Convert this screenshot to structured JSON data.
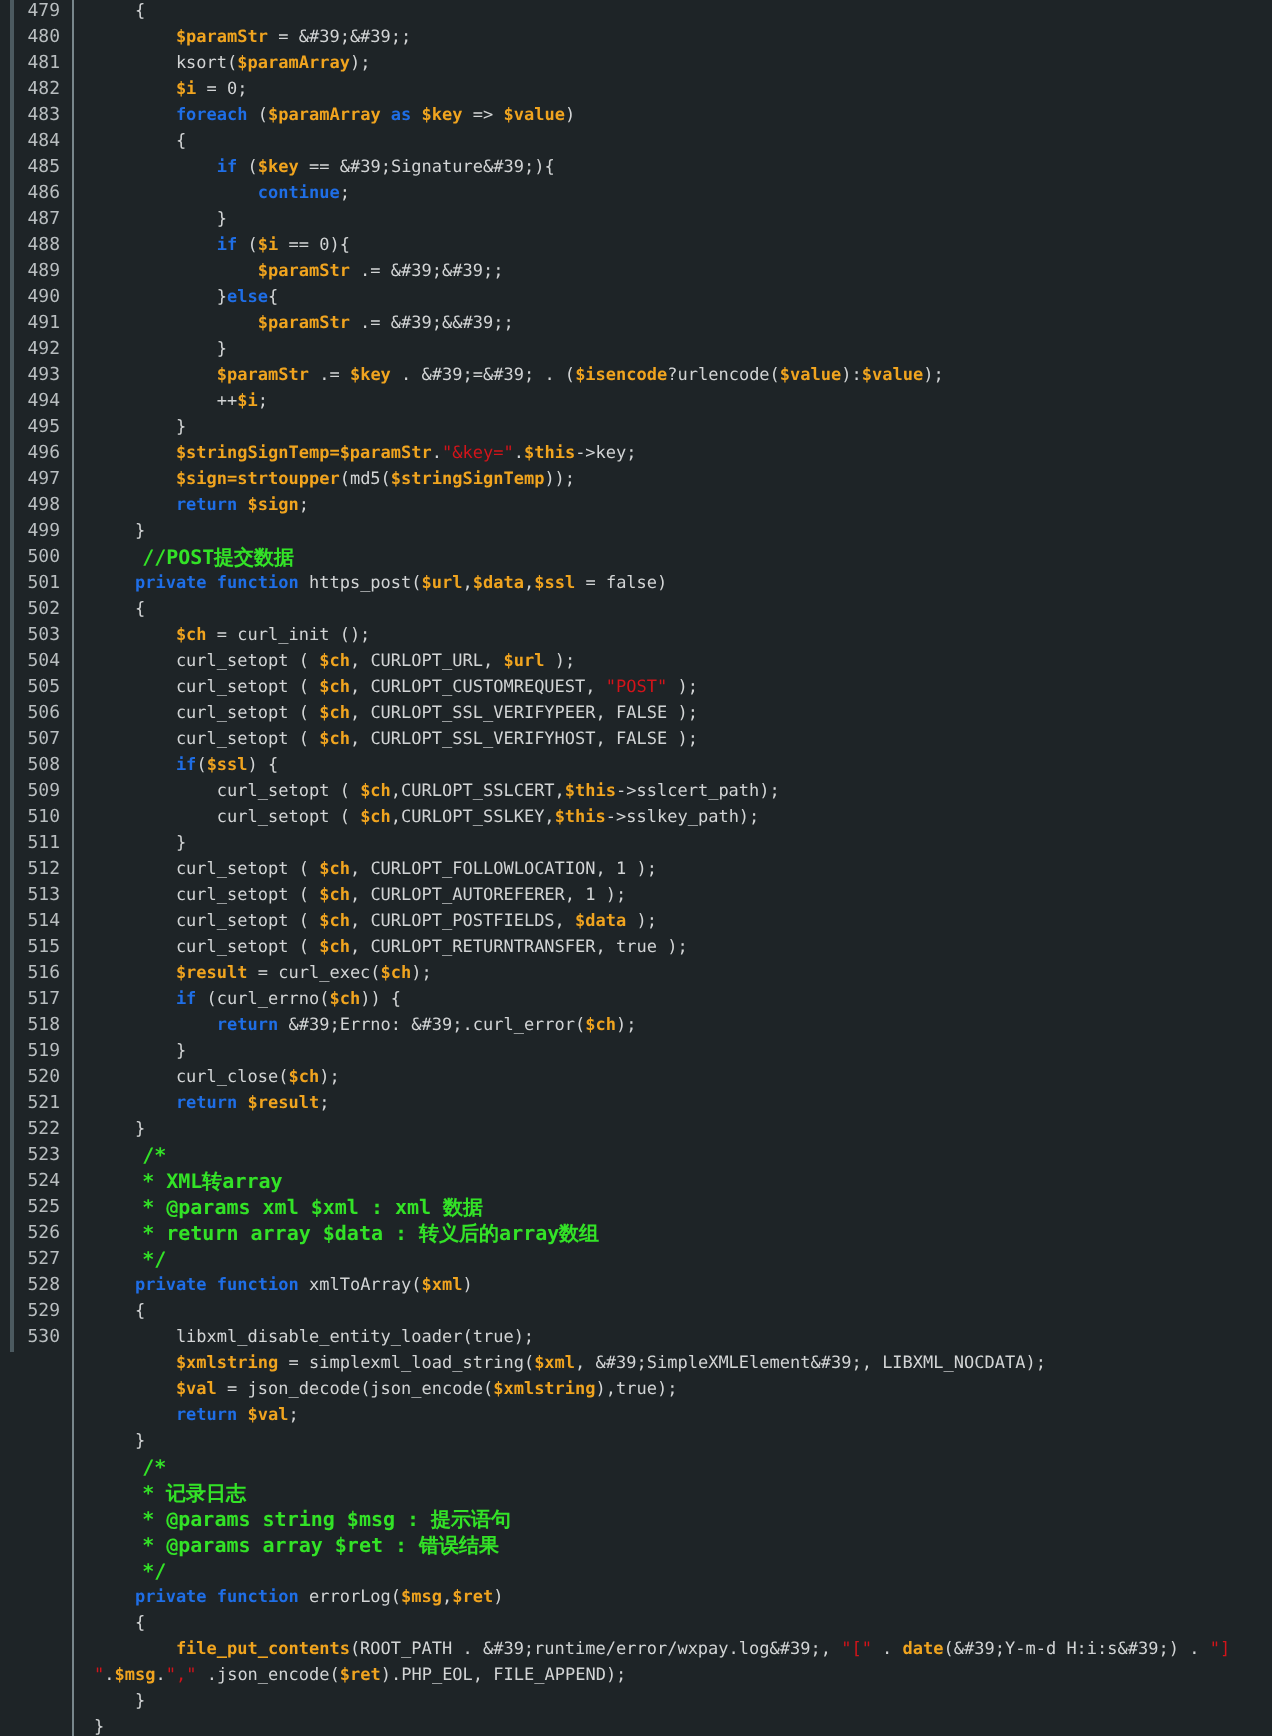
{
  "editor": {
    "lines": [
      {
        "number": "479",
        "tokens": [
          {
            "kind": "plain",
            "text": "    {"
          }
        ]
      },
      {
        "number": "480",
        "tokens": [
          {
            "kind": "variable",
            "text": "        $paramStr"
          },
          {
            "kind": "plain",
            "text": " = &#39;&#39;;"
          }
        ]
      },
      {
        "number": "481",
        "tokens": [
          {
            "kind": "plain",
            "text": "        ksort("
          },
          {
            "kind": "variable",
            "text": "$paramArray"
          },
          {
            "kind": "plain",
            "text": ");"
          }
        ]
      },
      {
        "number": "482",
        "tokens": [
          {
            "kind": "variable",
            "text": "        $i"
          },
          {
            "kind": "plain",
            "text": " = 0;"
          }
        ]
      },
      {
        "number": "483",
        "tokens": [
          {
            "kind": "keyword",
            "text": "        foreach"
          },
          {
            "kind": "plain",
            "text": " ("
          },
          {
            "kind": "variable",
            "text": "$paramArray"
          },
          {
            "kind": "keyword",
            "text": " as "
          },
          {
            "kind": "variable",
            "text": "$key"
          },
          {
            "kind": "plain",
            "text": " => "
          },
          {
            "kind": "variable",
            "text": "$value"
          },
          {
            "kind": "plain",
            "text": ")"
          }
        ]
      },
      {
        "number": "484",
        "tokens": [
          {
            "kind": "plain",
            "text": "        {"
          }
        ]
      },
      {
        "number": "485",
        "tokens": [
          {
            "kind": "keyword",
            "text": "            if"
          },
          {
            "kind": "plain",
            "text": " ("
          },
          {
            "kind": "variable",
            "text": "$key"
          },
          {
            "kind": "plain",
            "text": " == &#39;Signature&#39;){"
          }
        ]
      },
      {
        "number": "486",
        "tokens": [
          {
            "kind": "keyword",
            "text": "                continue"
          },
          {
            "kind": "plain",
            "text": ";"
          }
        ]
      },
      {
        "number": "487",
        "tokens": [
          {
            "kind": "plain",
            "text": "            }"
          }
        ]
      },
      {
        "number": "488",
        "tokens": [
          {
            "kind": "keyword",
            "text": "            if"
          },
          {
            "kind": "plain",
            "text": " ("
          },
          {
            "kind": "variable",
            "text": "$i"
          },
          {
            "kind": "plain",
            "text": " == 0){"
          }
        ]
      },
      {
        "number": "489",
        "tokens": [
          {
            "kind": "variable",
            "text": "                $paramStr"
          },
          {
            "kind": "plain",
            "text": " .= &#39;&#39;;"
          }
        ]
      },
      {
        "number": "490",
        "tokens": [
          {
            "kind": "plain",
            "text": "            }"
          },
          {
            "kind": "keyword",
            "text": "else"
          },
          {
            "kind": "plain",
            "text": "{"
          }
        ]
      },
      {
        "number": "491",
        "tokens": [
          {
            "kind": "variable",
            "text": "                $paramStr"
          },
          {
            "kind": "plain",
            "text": " .= &#39;&&#39;;"
          }
        ]
      },
      {
        "number": "492",
        "tokens": [
          {
            "kind": "plain",
            "text": "            }"
          }
        ]
      },
      {
        "number": "493",
        "tokens": [
          {
            "kind": "variable",
            "text": "            $paramStr"
          },
          {
            "kind": "plain",
            "text": " .= "
          },
          {
            "kind": "variable",
            "text": "$key"
          },
          {
            "kind": "plain",
            "text": " . &#39;=&#39; . ("
          },
          {
            "kind": "variable",
            "text": "$isencode"
          },
          {
            "kind": "plain",
            "text": "?urlencode("
          },
          {
            "kind": "variable",
            "text": "$value"
          },
          {
            "kind": "plain",
            "text": "):"
          },
          {
            "kind": "variable",
            "text": "$value"
          },
          {
            "kind": "plain",
            "text": ");"
          }
        ]
      },
      {
        "number": "494",
        "tokens": [
          {
            "kind": "plain",
            "text": "            ++"
          },
          {
            "kind": "variable",
            "text": "$i"
          },
          {
            "kind": "plain",
            "text": ";"
          }
        ]
      },
      {
        "number": "495",
        "tokens": [
          {
            "kind": "plain",
            "text": "        }"
          }
        ]
      },
      {
        "number": "496",
        "tokens": [
          {
            "kind": "variable",
            "text": "        $stringSignTemp=$paramStr"
          },
          {
            "kind": "plain",
            "text": "."
          },
          {
            "kind": "string",
            "text": "\"&key=\""
          },
          {
            "kind": "plain",
            "text": "."
          },
          {
            "kind": "variable",
            "text": "$this"
          },
          {
            "kind": "plain",
            "text": "->key;"
          }
        ]
      },
      {
        "number": "497",
        "tokens": [
          {
            "kind": "variable",
            "text": "        $sign=strtoupper"
          },
          {
            "kind": "plain",
            "text": "(md5("
          },
          {
            "kind": "variable",
            "text": "$stringSignTemp"
          },
          {
            "kind": "plain",
            "text": "));"
          }
        ]
      },
      {
        "number": "498",
        "tokens": [
          {
            "kind": "keyword",
            "text": "        return "
          },
          {
            "kind": "variable",
            "text": "$sign"
          },
          {
            "kind": "plain",
            "text": ";"
          }
        ]
      },
      {
        "number": "499",
        "tokens": [
          {
            "kind": "plain",
            "text": "    }"
          }
        ]
      },
      {
        "number": "500",
        "tokens": [
          {
            "kind": "comment",
            "text": "    //POST提交数据"
          }
        ]
      },
      {
        "number": "501",
        "tokens": [
          {
            "kind": "keyword",
            "text": "    private function"
          },
          {
            "kind": "plain",
            "text": " https_post("
          },
          {
            "kind": "variable",
            "text": "$url"
          },
          {
            "kind": "plain",
            "text": ","
          },
          {
            "kind": "variable",
            "text": "$data"
          },
          {
            "kind": "plain",
            "text": ","
          },
          {
            "kind": "variable",
            "text": "$ssl"
          },
          {
            "kind": "plain",
            "text": " = false)"
          }
        ]
      },
      {
        "number": "502",
        "tokens": [
          {
            "kind": "plain",
            "text": "    {"
          }
        ]
      },
      {
        "number": "503",
        "tokens": [
          {
            "kind": "variable",
            "text": "        $ch"
          },
          {
            "kind": "plain",
            "text": " = curl_init ();"
          }
        ]
      },
      {
        "number": "504",
        "tokens": [
          {
            "kind": "plain",
            "text": "        curl_setopt ( "
          },
          {
            "kind": "variable",
            "text": "$ch"
          },
          {
            "kind": "plain",
            "text": ", CURLOPT_URL, "
          },
          {
            "kind": "variable",
            "text": "$url"
          },
          {
            "kind": "plain",
            "text": " );"
          }
        ]
      },
      {
        "number": "505",
        "tokens": [
          {
            "kind": "plain",
            "text": "        curl_setopt ( "
          },
          {
            "kind": "variable",
            "text": "$ch"
          },
          {
            "kind": "plain",
            "text": ", CURLOPT_CUSTOMREQUEST, "
          },
          {
            "kind": "string",
            "text": "\"POST\""
          },
          {
            "kind": "plain",
            "text": " );"
          }
        ]
      },
      {
        "number": "506",
        "tokens": [
          {
            "kind": "plain",
            "text": "        curl_setopt ( "
          },
          {
            "kind": "variable",
            "text": "$ch"
          },
          {
            "kind": "plain",
            "text": ", CURLOPT_SSL_VERIFYPEER, FALSE );"
          }
        ]
      },
      {
        "number": "507",
        "tokens": [
          {
            "kind": "plain",
            "text": "        curl_setopt ( "
          },
          {
            "kind": "variable",
            "text": "$ch"
          },
          {
            "kind": "plain",
            "text": ", CURLOPT_SSL_VERIFYHOST, FALSE );"
          }
        ]
      },
      {
        "number": "508",
        "tokens": [
          {
            "kind": "keyword",
            "text": "        if"
          },
          {
            "kind": "plain",
            "text": "("
          },
          {
            "kind": "variable",
            "text": "$ssl"
          },
          {
            "kind": "plain",
            "text": ") {"
          }
        ]
      },
      {
        "number": "509",
        "tokens": [
          {
            "kind": "plain",
            "text": "            curl_setopt ( "
          },
          {
            "kind": "variable",
            "text": "$ch"
          },
          {
            "kind": "plain",
            "text": ",CURLOPT_SSLCERT,"
          },
          {
            "kind": "variable",
            "text": "$this"
          },
          {
            "kind": "plain",
            "text": "->sslcert_path);"
          }
        ]
      },
      {
        "number": "510",
        "tokens": [
          {
            "kind": "plain",
            "text": "            curl_setopt ( "
          },
          {
            "kind": "variable",
            "text": "$ch"
          },
          {
            "kind": "plain",
            "text": ",CURLOPT_SSLKEY,"
          },
          {
            "kind": "variable",
            "text": "$this"
          },
          {
            "kind": "plain",
            "text": "->sslkey_path);"
          }
        ]
      },
      {
        "number": "511",
        "tokens": [
          {
            "kind": "plain",
            "text": "        }"
          }
        ]
      },
      {
        "number": "512",
        "tokens": [
          {
            "kind": "plain",
            "text": "        curl_setopt ( "
          },
          {
            "kind": "variable",
            "text": "$ch"
          },
          {
            "kind": "plain",
            "text": ", CURLOPT_FOLLOWLOCATION, 1 );"
          }
        ]
      },
      {
        "number": "513",
        "tokens": [
          {
            "kind": "plain",
            "text": "        curl_setopt ( "
          },
          {
            "kind": "variable",
            "text": "$ch"
          },
          {
            "kind": "plain",
            "text": ", CURLOPT_AUTOREFERER, 1 );"
          }
        ]
      },
      {
        "number": "514",
        "tokens": [
          {
            "kind": "plain",
            "text": "        curl_setopt ( "
          },
          {
            "kind": "variable",
            "text": "$ch"
          },
          {
            "kind": "plain",
            "text": ", CURLOPT_POSTFIELDS, "
          },
          {
            "kind": "variable",
            "text": "$data"
          },
          {
            "kind": "plain",
            "text": " );"
          }
        ]
      },
      {
        "number": "515",
        "tokens": [
          {
            "kind": "plain",
            "text": "        curl_setopt ( "
          },
          {
            "kind": "variable",
            "text": "$ch"
          },
          {
            "kind": "plain",
            "text": ", CURLOPT_RETURNTRANSFER, true );"
          }
        ]
      },
      {
        "number": "516",
        "tokens": [
          {
            "kind": "variable",
            "text": "        $result"
          },
          {
            "kind": "plain",
            "text": " = curl_exec("
          },
          {
            "kind": "variable",
            "text": "$ch"
          },
          {
            "kind": "plain",
            "text": ");"
          }
        ]
      },
      {
        "number": "517",
        "tokens": [
          {
            "kind": "keyword",
            "text": "        if"
          },
          {
            "kind": "plain",
            "text": " (curl_errno("
          },
          {
            "kind": "variable",
            "text": "$ch"
          },
          {
            "kind": "plain",
            "text": ")) {"
          }
        ]
      },
      {
        "number": "518",
        "tokens": [
          {
            "kind": "keyword",
            "text": "            return"
          },
          {
            "kind": "plain",
            "text": " &#39;Errno: &#39;.curl_error("
          },
          {
            "kind": "variable",
            "text": "$ch"
          },
          {
            "kind": "plain",
            "text": ");"
          }
        ]
      },
      {
        "number": "519",
        "tokens": [
          {
            "kind": "plain",
            "text": "        }"
          }
        ]
      },
      {
        "number": "520",
        "tokens": [
          {
            "kind": "plain",
            "text": "        curl_close("
          },
          {
            "kind": "variable",
            "text": "$ch"
          },
          {
            "kind": "plain",
            "text": ");"
          }
        ]
      },
      {
        "number": "521",
        "tokens": [
          {
            "kind": "keyword",
            "text": "        return "
          },
          {
            "kind": "variable",
            "text": "$result"
          },
          {
            "kind": "plain",
            "text": ";"
          }
        ]
      },
      {
        "number": "522",
        "tokens": [
          {
            "kind": "plain",
            "text": "    }"
          }
        ]
      },
      {
        "number": "523",
        "tokens": [
          {
            "kind": "comment",
            "text": "    /*"
          }
        ]
      },
      {
        "number": "524",
        "tokens": [
          {
            "kind": "comment",
            "text": "    * XML转array"
          }
        ]
      },
      {
        "number": "525",
        "tokens": [
          {
            "kind": "comment",
            "text": "    * @params xml $xml : xml 数据"
          }
        ]
      },
      {
        "number": "526",
        "tokens": [
          {
            "kind": "comment",
            "text": "    * return array $data : 转义后的array数组"
          }
        ]
      },
      {
        "number": "527",
        "tokens": [
          {
            "kind": "comment",
            "text": "    */"
          }
        ]
      },
      {
        "number": "528",
        "tokens": [
          {
            "kind": "keyword",
            "text": "    private function"
          },
          {
            "kind": "plain",
            "text": " xmlToArray("
          },
          {
            "kind": "variable",
            "text": "$xml"
          },
          {
            "kind": "plain",
            "text": ")"
          }
        ]
      },
      {
        "number": "529",
        "tokens": [
          {
            "kind": "plain",
            "text": "    {"
          }
        ]
      },
      {
        "number": "530",
        "tokens": [
          {
            "kind": "plain",
            "text": "        libxml_disable_entity_loader(true);"
          }
        ]
      },
      {
        "tokens": [
          {
            "kind": "variable",
            "text": "        $xmlstring"
          },
          {
            "kind": "plain",
            "text": " = simplexml_load_string("
          },
          {
            "kind": "variable",
            "text": "$xml"
          },
          {
            "kind": "plain",
            "text": ", &#39;SimpleXMLElement&#39;, LIBXML_NOCDATA);"
          }
        ]
      },
      {
        "tokens": [
          {
            "kind": "variable",
            "text": "        $val"
          },
          {
            "kind": "plain",
            "text": " = json_decode(json_encode("
          },
          {
            "kind": "variable",
            "text": "$xmlstring"
          },
          {
            "kind": "plain",
            "text": "),true);"
          }
        ]
      },
      {
        "tokens": [
          {
            "kind": "keyword",
            "text": "        return "
          },
          {
            "kind": "variable",
            "text": "$val"
          },
          {
            "kind": "plain",
            "text": ";"
          }
        ]
      },
      {
        "tokens": [
          {
            "kind": "plain",
            "text": "    }"
          }
        ]
      },
      {
        "tokens": [
          {
            "kind": "comment",
            "text": "    /*"
          }
        ]
      },
      {
        "tokens": [
          {
            "kind": "comment",
            "text": "    * 记录日志"
          }
        ]
      },
      {
        "tokens": [
          {
            "kind": "comment",
            "text": "    * @params string $msg : 提示语句"
          }
        ]
      },
      {
        "tokens": [
          {
            "kind": "comment",
            "text": "    * @params array $ret : 错误结果"
          }
        ]
      },
      {
        "tokens": [
          {
            "kind": "comment",
            "text": "    */"
          }
        ]
      },
      {
        "tokens": [
          {
            "kind": "keyword",
            "text": "    private function"
          },
          {
            "kind": "plain",
            "text": " errorLog("
          },
          {
            "kind": "variable",
            "text": "$msg"
          },
          {
            "kind": "plain",
            "text": ","
          },
          {
            "kind": "variable",
            "text": "$ret"
          },
          {
            "kind": "plain",
            "text": ")"
          }
        ]
      },
      {
        "tokens": [
          {
            "kind": "plain",
            "text": "    {"
          }
        ]
      },
      {
        "tokens": [
          {
            "kind": "variable",
            "text": "        file_put_contents"
          },
          {
            "kind": "plain",
            "text": "(ROOT_PATH . &#39;runtime/error/wxpay.log&#39;, "
          },
          {
            "kind": "string",
            "text": "\"[\""
          },
          {
            "kind": "plain",
            "text": " . "
          },
          {
            "kind": "variable",
            "text": "date"
          },
          {
            "kind": "plain",
            "text": "(&#39;Y-m-d H:i:s&#39;) . "
          },
          {
            "kind": "string",
            "text": "\"]"
          }
        ]
      },
      {
        "tokens": [
          {
            "kind": "string",
            "text": "\""
          },
          {
            "kind": "plain",
            "text": "."
          },
          {
            "kind": "variable",
            "text": "$msg"
          },
          {
            "kind": "plain",
            "text": "."
          },
          {
            "kind": "string",
            "text": "\",\""
          },
          {
            "kind": "plain",
            "text": " .json_encode("
          },
          {
            "kind": "variable",
            "text": "$ret"
          },
          {
            "kind": "plain",
            "text": ").PHP_EOL, FILE_APPEND);"
          }
        ]
      },
      {
        "tokens": [
          {
            "kind": "plain",
            "text": "    }"
          }
        ]
      },
      {
        "tokens": [
          {
            "kind": "plain",
            "text": "}"
          }
        ]
      }
    ]
  }
}
